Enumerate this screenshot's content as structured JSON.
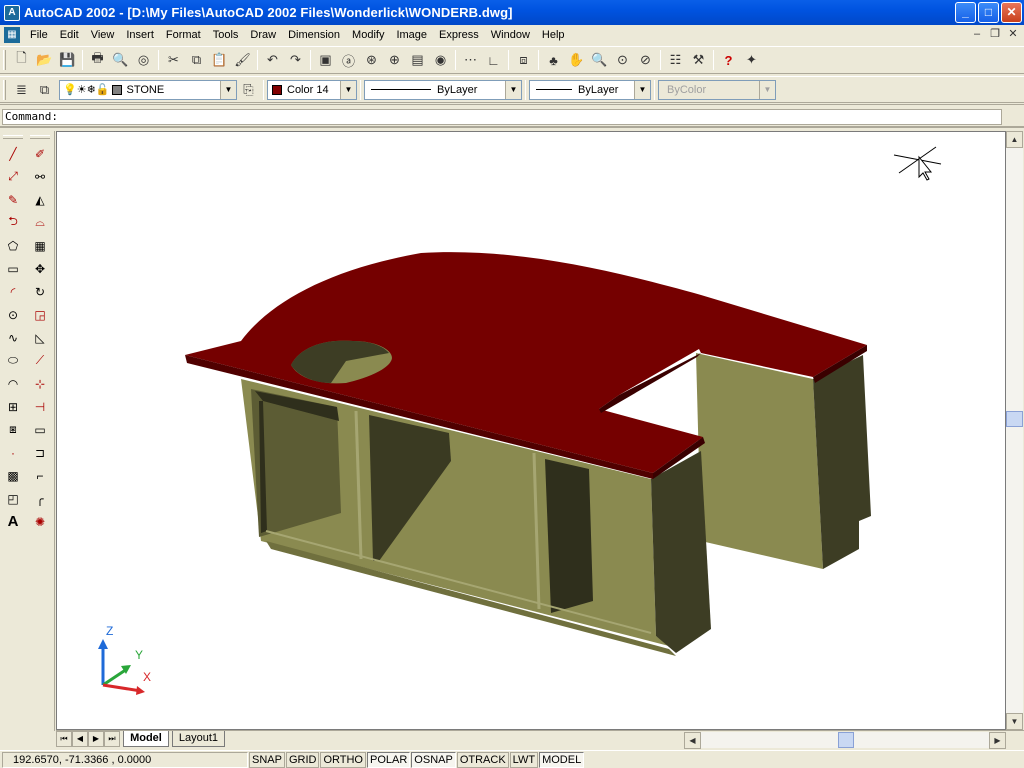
{
  "window": {
    "title": "AutoCAD 2002 - [D:\\My Files\\AutoCAD 2002  Files\\Wonderlick\\WONDERB.dwg]",
    "app_icon": "autocad-logo"
  },
  "menu": {
    "items": [
      "File",
      "Edit",
      "View",
      "Insert",
      "Format",
      "Tools",
      "Draw",
      "Dimension",
      "Modify",
      "Image",
      "Express",
      "Window",
      "Help"
    ]
  },
  "properties_toolbar": {
    "layer": "STONE",
    "color": "Color 14",
    "color_swatch": "#800000",
    "linetype": "ByLayer",
    "lineweight": "ByLayer",
    "plotstyle": "ByColor"
  },
  "command": {
    "prompt": "Command:",
    "value": ""
  },
  "layout_tabs": [
    "Model",
    "Layout1"
  ],
  "status": {
    "coords": "192.6570, -71.3366 , 0.0000",
    "buttons": [
      "SNAP",
      "GRID",
      "ORTHO",
      "POLAR",
      "OSNAP",
      "OTRACK",
      "LWT",
      "MODEL"
    ],
    "active": [
      "POLAR",
      "OSNAP",
      "MODEL"
    ]
  },
  "ucs": {
    "x": "X",
    "y": "Y",
    "z": "Z"
  },
  "colors": {
    "countertop": "#800000",
    "cabinet": "#8a8a50",
    "cabinet_dark": "#3a3a22",
    "titlebar": "#0055e5"
  }
}
